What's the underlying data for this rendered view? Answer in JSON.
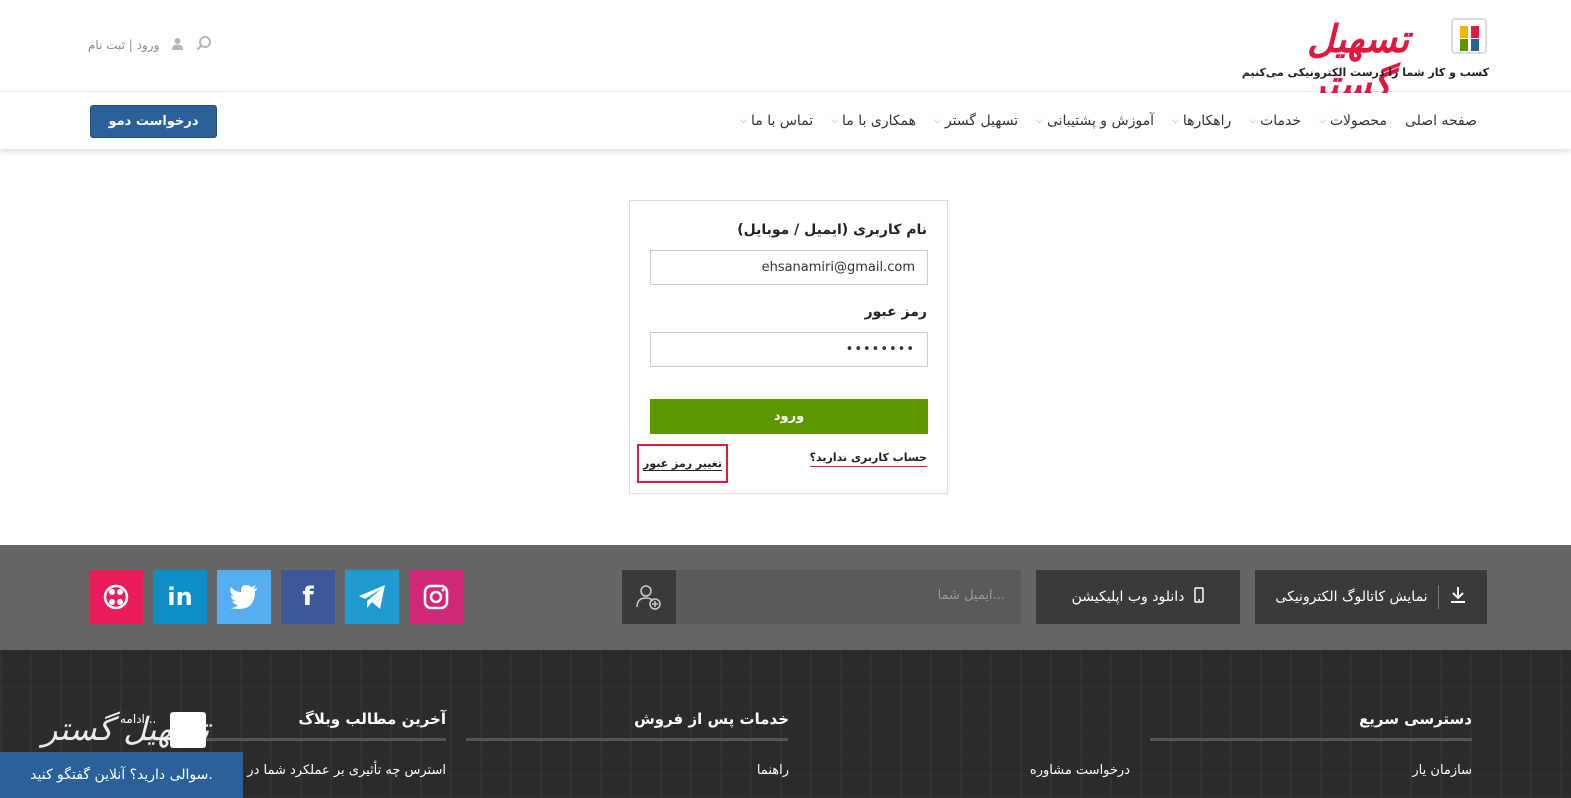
{
  "header": {
    "logo_text": "تسهیل گستر",
    "tagline": "کسب و کار شما را درست الکترونیکی می‌کنیم",
    "user_links": "ورود | ثبت نام"
  },
  "nav": {
    "items": [
      {
        "label": "صفحه اصلی",
        "has_menu": false
      },
      {
        "label": "محصولات",
        "has_menu": true
      },
      {
        "label": "خدمات",
        "has_menu": true
      },
      {
        "label": "راهکارها",
        "has_menu": true
      },
      {
        "label": "آموزش و پشتیبانی",
        "has_menu": true
      },
      {
        "label": "تسهیل گستر",
        "has_menu": true
      },
      {
        "label": "همکاری با ما",
        "has_menu": true
      },
      {
        "label": "تماس با ما",
        "has_menu": true
      }
    ],
    "demo_button": "درخواست دمو"
  },
  "login": {
    "username_label": "نام کاربری (ایمیل / موبایل)",
    "username_value": "ehsanamiri@gmail.com",
    "password_label": "رمز عبور",
    "password_value": "••••••••",
    "submit_label": "ورود",
    "signup_link": "حساب کاربری ندارید؟",
    "change_password_link": "تغییر رمز عبور"
  },
  "footer": {
    "catalog_button": "نمایش کاتالوگ الکترونیکی",
    "webapp_button": "دانلود وب اپلیکیشن",
    "email_placeholder": "ایمیل شما...",
    "columns": [
      {
        "title": "دسترسی سریع",
        "link": "سازمان یار"
      },
      {
        "title": "",
        "link": "درخواست مشاوره"
      },
      {
        "title": "خدمات پس از فروش",
        "link": "راهنما"
      },
      {
        "title": "آخرین مطالب وبلاگ",
        "link": "استرس چه تأثیری بر عملکرد شما در م"
      }
    ],
    "read_more": "ادامه...",
    "chat_text": "سوالی دارید؟ آنلاین گفتگو کنید.",
    "social": [
      "instagram-icon",
      "telegram-icon",
      "facebook-icon",
      "twitter-icon",
      "linkedin-icon",
      "aparat-icon"
    ]
  },
  "colors": {
    "brand_red": "#e3173e",
    "demo_blue": "#2b6098",
    "login_green": "#5e9600",
    "instagram": "#d3287a",
    "telegram": "#1d9bd1",
    "facebook": "#3b5998",
    "twitter": "#55acee",
    "linkedin": "#0e8ec4",
    "aparat": "#ea1c5a"
  }
}
